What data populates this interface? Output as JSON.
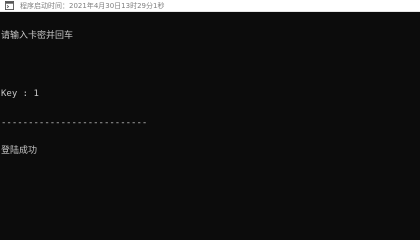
{
  "window": {
    "title": "程序启动时间：2021年4月30日13时29分1秒",
    "icon": "console-app-icon"
  },
  "console": {
    "lines": [
      "请输入卡密并回车",
      "",
      "Key : 1",
      "---------------------------",
      "登陆成功"
    ]
  },
  "colors": {
    "background": "#0c0c0c",
    "text": "#c8c8c8",
    "titlebar": "#ffffff"
  }
}
